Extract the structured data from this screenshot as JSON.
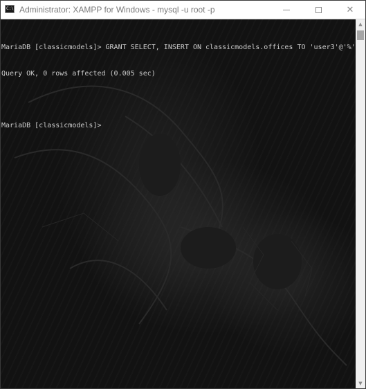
{
  "window": {
    "title": "Administrator:  XAMPP for Windows - mysql  -u root -p",
    "icon": "console-app-icon",
    "icon_text": "C:\\"
  },
  "controls": {
    "minimize": "minimize-icon",
    "maximize": "maximize-icon",
    "close": "close-icon",
    "close_glyph": "✕"
  },
  "console": {
    "lines": [
      "MariaDB [classicmodels]> GRANT SELECT, INSERT ON classicmodels.offices TO 'user3'@'%';",
      "Query OK, 0 rows affected (0.005 sec)",
      "",
      "MariaDB [classicmodels]>"
    ],
    "text_color": "#cccccc",
    "background_color": "#121212"
  },
  "scrollbar": {
    "up_glyph": "▲",
    "down_glyph": "▼"
  }
}
